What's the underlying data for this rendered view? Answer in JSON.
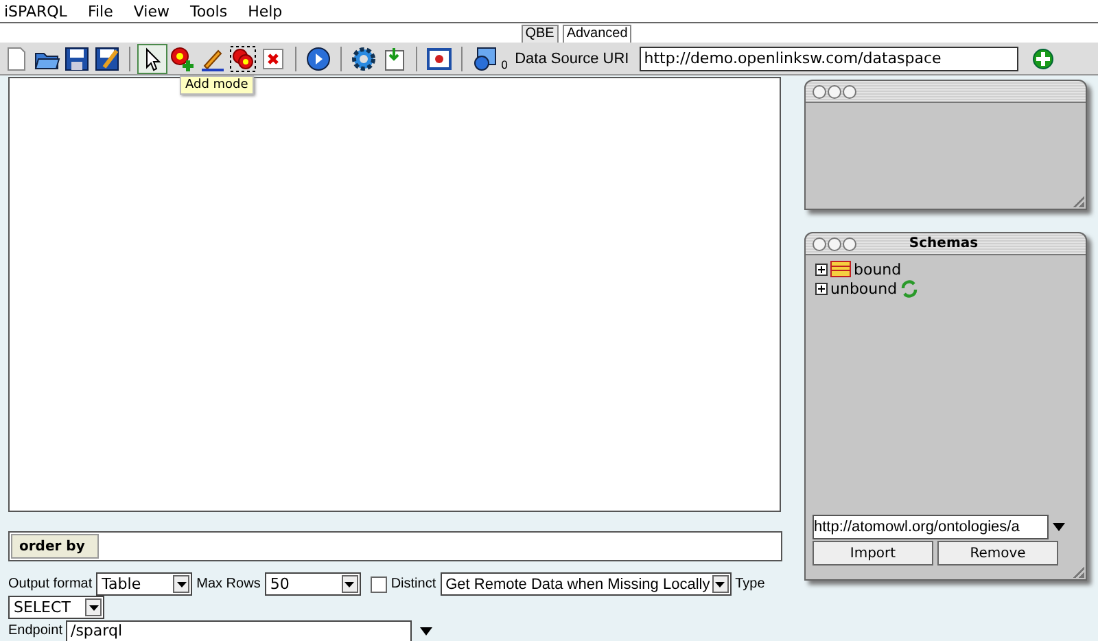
{
  "menu": [
    {
      "label": "iSPARQL"
    },
    {
      "label": "File"
    },
    {
      "label": "View"
    },
    {
      "label": "Tools"
    },
    {
      "label": "Help"
    }
  ],
  "tabs": [
    {
      "label": "QBE",
      "selected": true
    },
    {
      "label": "Advanced",
      "selected": false
    }
  ],
  "mode_tools": [
    {
      "selected": true
    },
    {
      "selected": false
    },
    {
      "selected": false
    },
    {
      "selected": false
    },
    {
      "selected": false
    }
  ],
  "tooltip": "Add mode",
  "data_source": {
    "count": "0",
    "label": "Data Source URI",
    "uri": "http://demo.openlinksw.com/dataspace"
  },
  "schemas": {
    "title": "Schemas",
    "tree": [
      {
        "label": "bound",
        "expanded": false
      },
      {
        "label": "unbound",
        "expanded": false
      }
    ],
    "ontology_url": "http://atomowl.org/ontologies/a",
    "buttons": [
      "Import",
      "Remove"
    ]
  },
  "order_by": {
    "label": "order by"
  },
  "options": {
    "output_format_label": "Output format",
    "output_format": "Table",
    "max_rows_label": "Max Rows",
    "max_rows": "50",
    "distinct": {
      "label": "Distinct",
      "checked": false
    },
    "remote": "Get Remote Data when Missing Locally",
    "type_label": "Type",
    "type": "SELECT",
    "endpoint_label": "Endpoint",
    "endpoint": "/sparql"
  }
}
